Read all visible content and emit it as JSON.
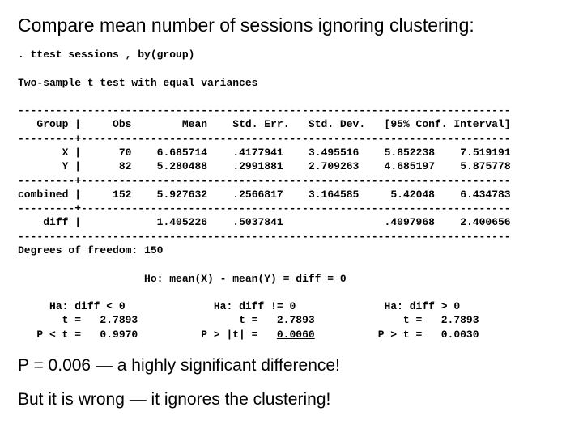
{
  "title": "Compare mean number of sessions ignoring clustering:",
  "cmd": ". ttest sessions , by(group)",
  "testname": "Two-sample t test with equal variances",
  "hdr": {
    "group": "Group",
    "obs": "Obs",
    "mean": "Mean",
    "stderr": "Std. Err.",
    "stddev": "Std. Dev.",
    "ci": "[95% Conf. Interval]"
  },
  "rows": {
    "x": {
      "label": "X",
      "obs": "70",
      "mean": "6.685714",
      "stderr": ".4177941",
      "stddev": "3.495516",
      "ci_lo": "5.852238",
      "ci_hi": "7.519191"
    },
    "y": {
      "label": "Y",
      "obs": "82",
      "mean": "5.280488",
      "stderr": ".2991881",
      "stddev": "2.709263",
      "ci_lo": "4.685197",
      "ci_hi": "5.875778"
    },
    "combined": {
      "label": "combined",
      "obs": "152",
      "mean": "5.927632",
      "stderr": ".2566817",
      "stddev": "3.164585",
      "ci_lo": "5.42048",
      "ci_hi": "6.434783"
    },
    "diff": {
      "label": "diff",
      "mean": "1.405226",
      "stderr": ".5037841",
      "ci_lo": ".4097968",
      "ci_hi": "2.400656"
    }
  },
  "df_line": "Degrees of freedom: 150",
  "ho": "Ho: mean(X) - mean(Y) = diff = 0",
  "ha": {
    "lt": {
      "title": "Ha: diff < 0",
      "t_lbl": "t =",
      "t": "2.7893",
      "p_lbl": "P < t =",
      "p": "0.9970"
    },
    "ne": {
      "title": "Ha: diff != 0",
      "t_lbl": "t =",
      "t": "2.7893",
      "p_lbl": "P > |t| =",
      "p": "0.0060"
    },
    "gt": {
      "title": "Ha: diff > 0",
      "t_lbl": "t =",
      "t": "2.7893",
      "p_lbl": "P > t =",
      "p": "0.0030"
    }
  },
  "footer1": "P = 0.006 — a highly significant difference!",
  "footer2": "But it is wrong — it ignores the clustering!"
}
